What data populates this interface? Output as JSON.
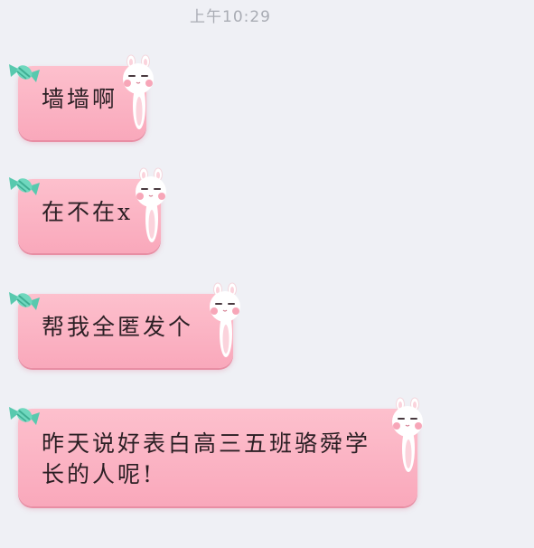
{
  "status": {
    "time": "上午10:29"
  },
  "messages": [
    {
      "text": "墙墙啊"
    },
    {
      "text": "在不在x"
    },
    {
      "text": "帮我全匿发个"
    },
    {
      "text": "昨天说好表白高三五班骆舜学长的人呢!"
    }
  ],
  "theme": {
    "background": "#eff0f5",
    "bubble_top": "#fdc0cd",
    "bubble_bottom": "#f9a8bb",
    "candy_color": "#5fcfb5",
    "bunny_color": "#ffffff",
    "bunny_cheek": "#f7a6b8"
  },
  "icons": {
    "decoration_left": "candy-icon",
    "decoration_right": "bunny-icon"
  }
}
